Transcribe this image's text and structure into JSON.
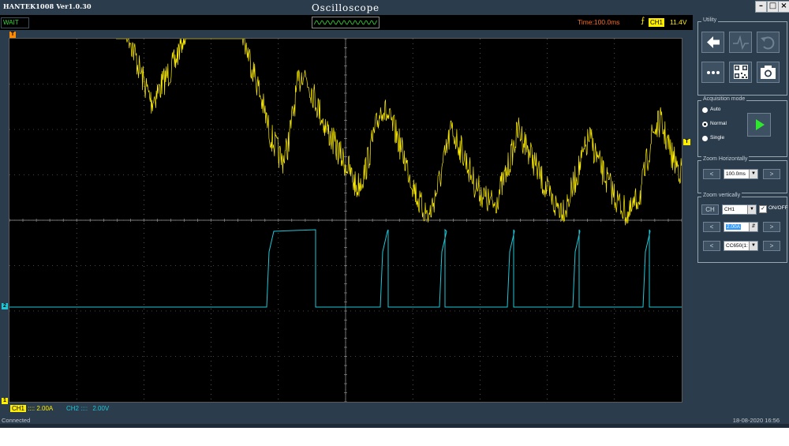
{
  "window": {
    "app_version": "HANTEK1008 Ver1.0.30",
    "title": "Oscilloscope",
    "minimize": "–",
    "maximize": "□",
    "close": "×"
  },
  "status_row": {
    "state": "WAIT",
    "timebase": "Time:100.0ms",
    "trigger_channel": "CH1",
    "trigger_level": "11.4V"
  },
  "screen": {
    "markers": {
      "trigger_position": "T",
      "trigger_level": "T",
      "ch1": "1",
      "ch2": "2"
    },
    "colors": {
      "ch1": "#ffee00",
      "ch2": "#1ec8d8",
      "grid": "#8c8c8c",
      "marker_orange": "#ff8c00"
    }
  },
  "channel_info": {
    "ch1_tag": "CH1",
    "ch1_value": ":::: 2.00A",
    "ch2_label": "CH2 ::::",
    "ch2_value": "2.00V"
  },
  "panel": {
    "utility": {
      "title": "Utility",
      "icons": [
        "back-arrow-icon",
        "waveform-icon",
        "undo-icon",
        "more-icon",
        "qr-code-icon",
        "camera-icon"
      ]
    },
    "acquisition": {
      "title": "Acquisition mode",
      "options": [
        "Auto",
        "Normal",
        "Single"
      ],
      "selected": "Normal"
    },
    "zoom_h": {
      "title": "Zoom Horizontally",
      "value": "100.0ms",
      "left": "<",
      "right": ">"
    },
    "zoom_v": {
      "title": "Zoom vertically",
      "ch_button": "CH",
      "channel": "CH1",
      "onoff": "ON/OFF",
      "scale": "2.00A",
      "probe": "CC650(1:",
      "left": "<",
      "right": ">"
    }
  },
  "statusbar": {
    "connection": "Connected",
    "datetime": "18-08-2020  16:56"
  }
}
